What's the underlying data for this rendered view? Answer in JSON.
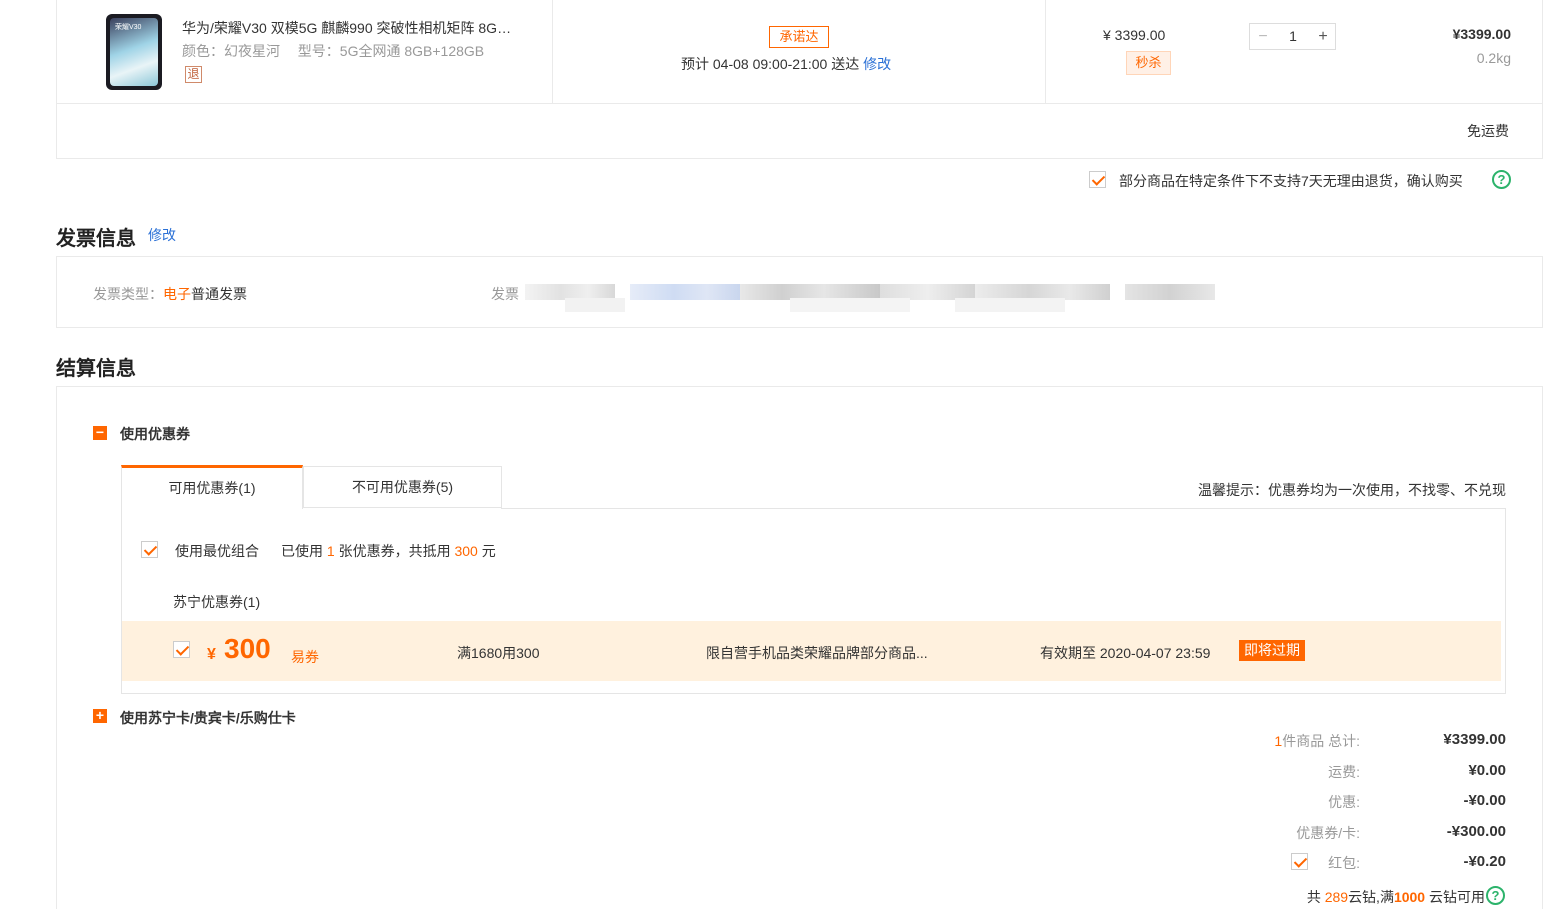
{
  "product": {
    "name": "华为/荣耀V30 双模5G 麒麟990 突破性相机矩阵 8G…",
    "color_label": "颜色：",
    "color_value": "幻夜星河",
    "model_label": "型号：",
    "model_value": "5G全网通 8GB+128GB",
    "return_badge": "退",
    "phone_screen_text": "荣耀V30",
    "promise_badge": "承诺达",
    "delivery_prefix": "预计 04-08 09:00-21:00  送达",
    "delivery_modify": "修改",
    "unit_price": "¥ 3399.00",
    "flash_sale_badge": "秒杀",
    "quantity": "1",
    "minus": "−",
    "plus": "+",
    "subtotal": "¥3399.00",
    "weight": "0.2kg",
    "shipping": "免运费"
  },
  "return_notice": {
    "text": "部分商品在特定条件下不支持7天无理由退货，确认购买",
    "help_icon": "?"
  },
  "invoice": {
    "title": "发票信息",
    "modify": "修改",
    "type_label": "发票类型：",
    "type_value_highlight": "电子",
    "type_value_rest": "普通发票",
    "header_label": "发票"
  },
  "settlement": {
    "title": "结算信息",
    "coupon_section": {
      "toggle_icon": "−",
      "title": "使用优惠券",
      "tabs": [
        {
          "label": "可用优惠券(1)"
        },
        {
          "label": "不可用优惠券(5)"
        }
      ],
      "tip": "温馨提示：优惠券均为一次使用，不找零、不兑现",
      "best_combo_label": "使用最优组合",
      "used_prefix": "已使用 ",
      "used_count": "1",
      "used_mid": " 张优惠券，共抵用 ",
      "used_amount": "300",
      "used_suffix": " 元",
      "group_title": "苏宁优惠券(1)",
      "coupon": {
        "currency": "¥",
        "amount": "300",
        "type": "易券",
        "condition": "满1680用300",
        "scope": "限自营手机品类荣耀品牌部分商品...",
        "validity": "有效期至 2020-04-07 23:59",
        "expiring_badge": "即将过期"
      }
    },
    "card_section": {
      "toggle_icon": "+",
      "title": "使用苏宁卡/贵宾卡/乐购仕卡"
    },
    "summary": {
      "items_count": "1",
      "items_label": "件商品 总计:",
      "items_total": "¥3399.00",
      "shipping_label": "运费:",
      "shipping_value": "¥0.00",
      "discount_label": "优惠:",
      "discount_value": "-¥0.00",
      "coupon_label": "优惠券/卡:",
      "coupon_value": "-¥300.00",
      "redpacket_label": "红包:",
      "redpacket_value": "-¥0.20",
      "yunzuan_prefix": "共 ",
      "yunzuan_count": "289",
      "yunzuan_mid": "云钻,满",
      "yunzuan_threshold": "1000",
      "yunzuan_suffix": " 云钻可用"
    }
  },
  "colors": {
    "accent": "#ff6600",
    "link": "#2a70d6",
    "coupon_row_bg": "#fff1de",
    "help_green": "#2cb36b"
  }
}
